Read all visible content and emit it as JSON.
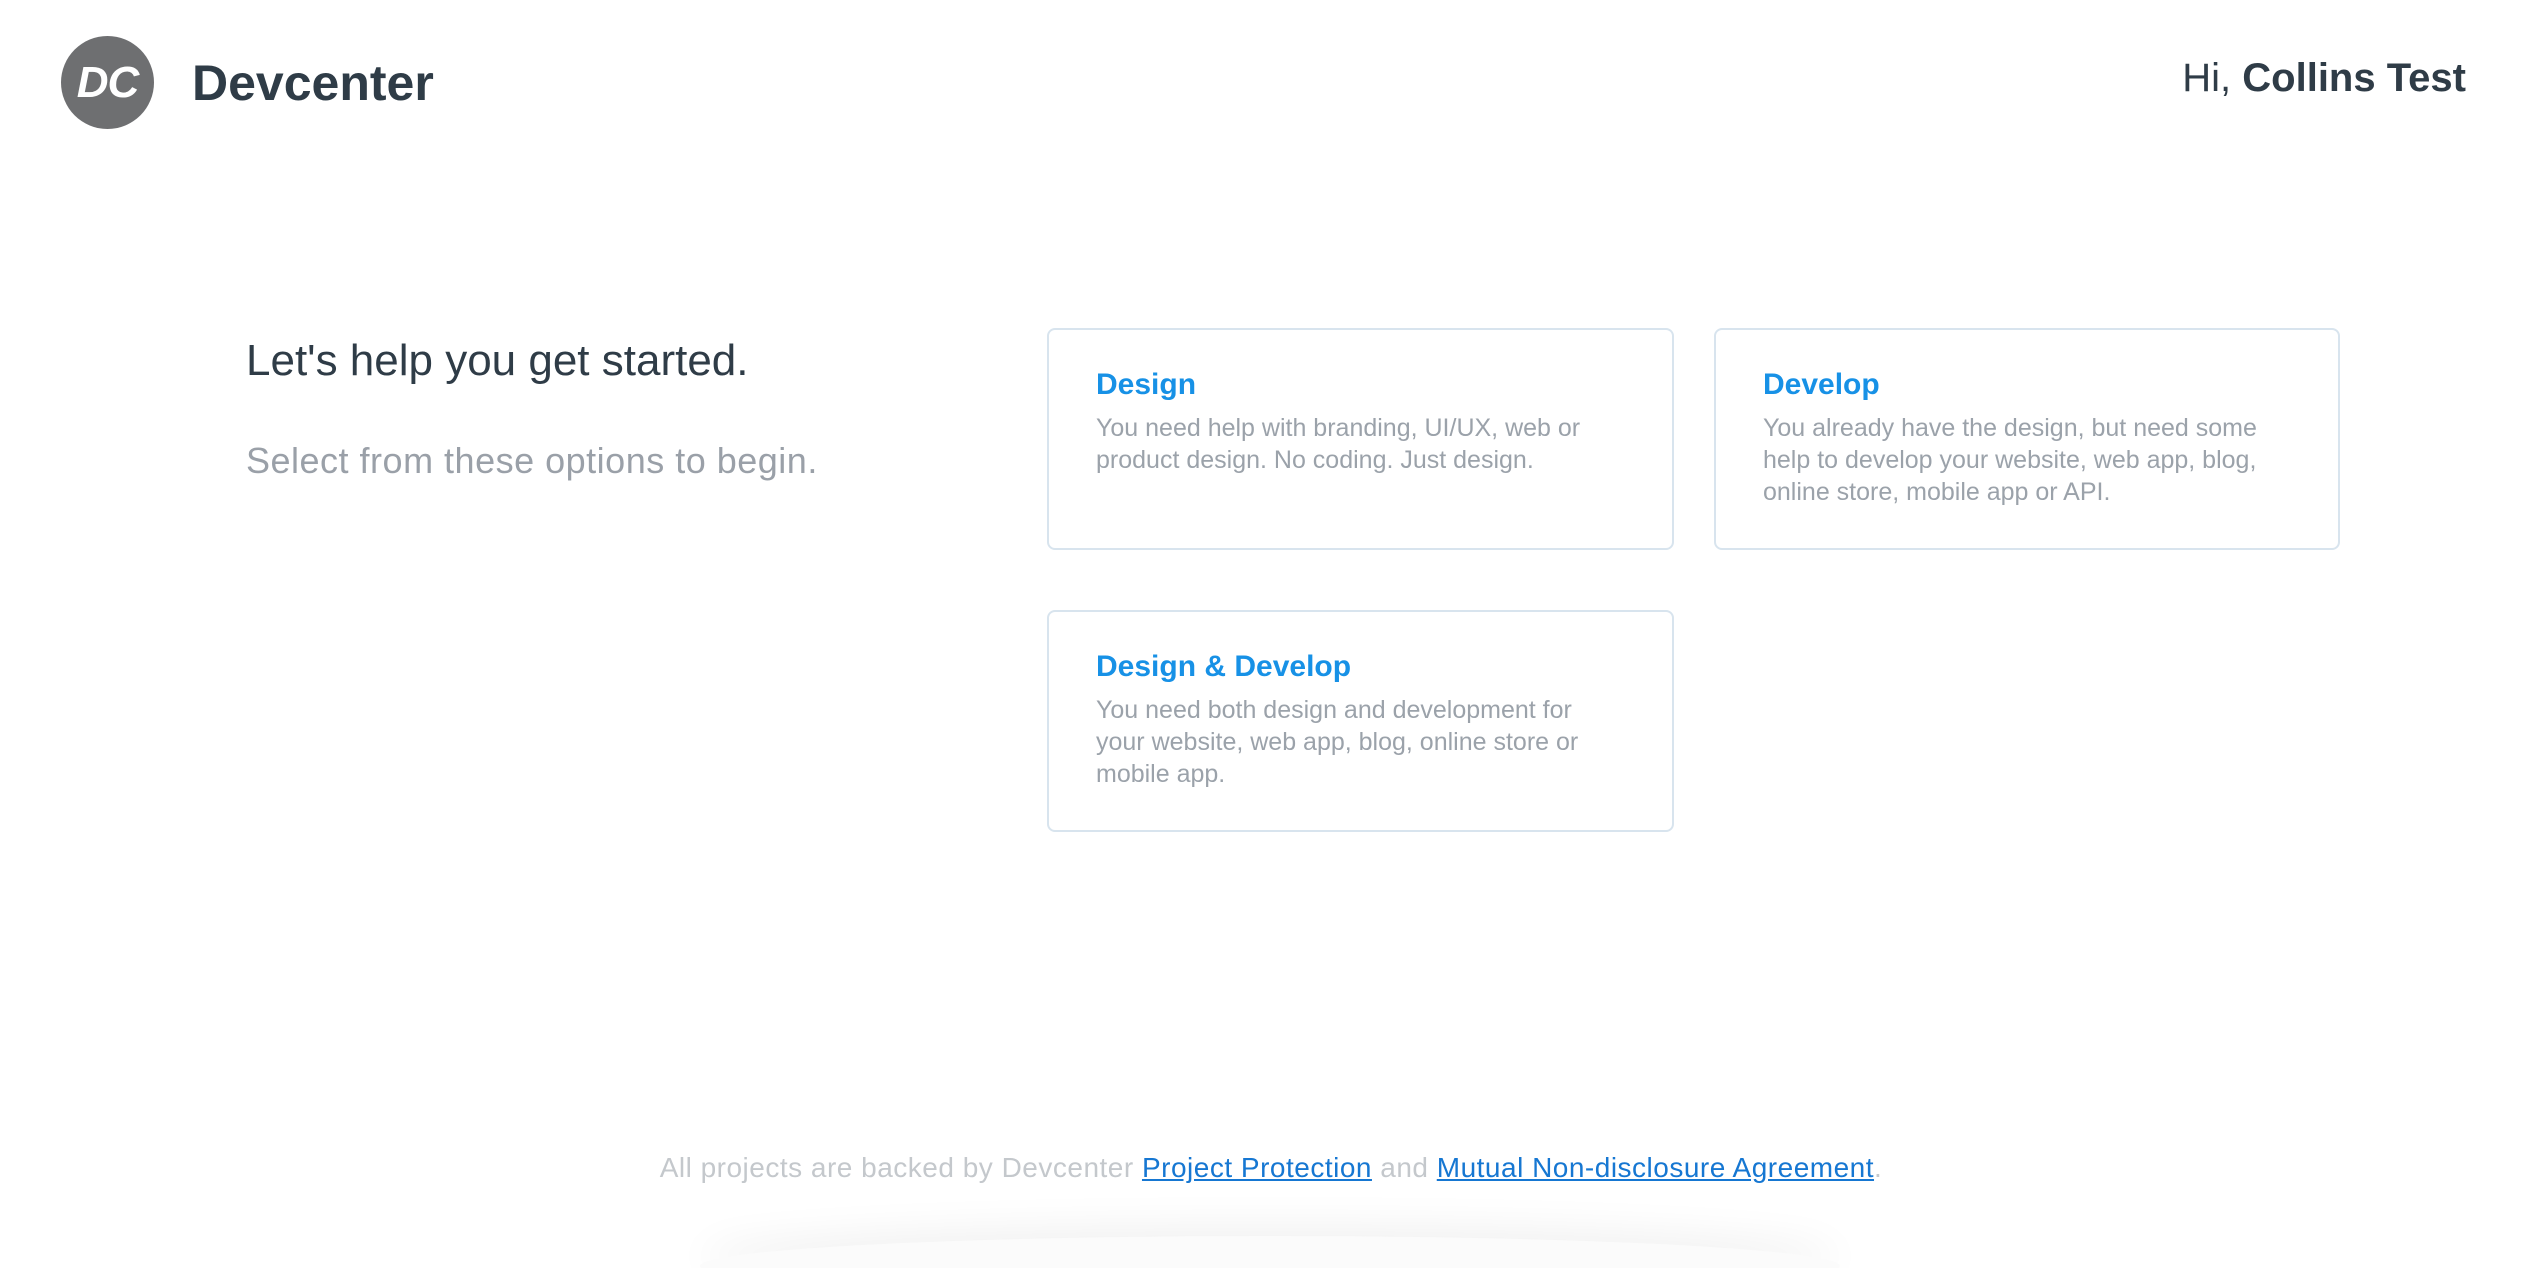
{
  "header": {
    "logo_text": "DC",
    "brand_name": "Devcenter",
    "greeting_prefix": "Hi,",
    "user_name": "Collins Test"
  },
  "intro": {
    "title": "Let's help you get started.",
    "subtitle": "Select from these options to begin."
  },
  "options": [
    {
      "title": "Design",
      "description": "You need help with branding, UI/UX, web or product design. No coding. Just design."
    },
    {
      "title": "Develop",
      "description": "You already have the design, but need some help to develop your website, web app, blog, online store, mobile app or API."
    },
    {
      "title": "Design & Develop",
      "description": "You need both design and development for your website, web app, blog, online store or mobile app."
    }
  ],
  "footer": {
    "text_before": "All projects are backed by Devcenter",
    "link_protection": "Project Protection",
    "text_and": "and",
    "link_nda": "Mutual Non-disclosure Agreement",
    "text_end": "."
  },
  "colors": {
    "accent": "#1791e6",
    "link": "#1677d2",
    "logo_bg": "#6e6f71",
    "card_border": "#d8e4ee"
  }
}
